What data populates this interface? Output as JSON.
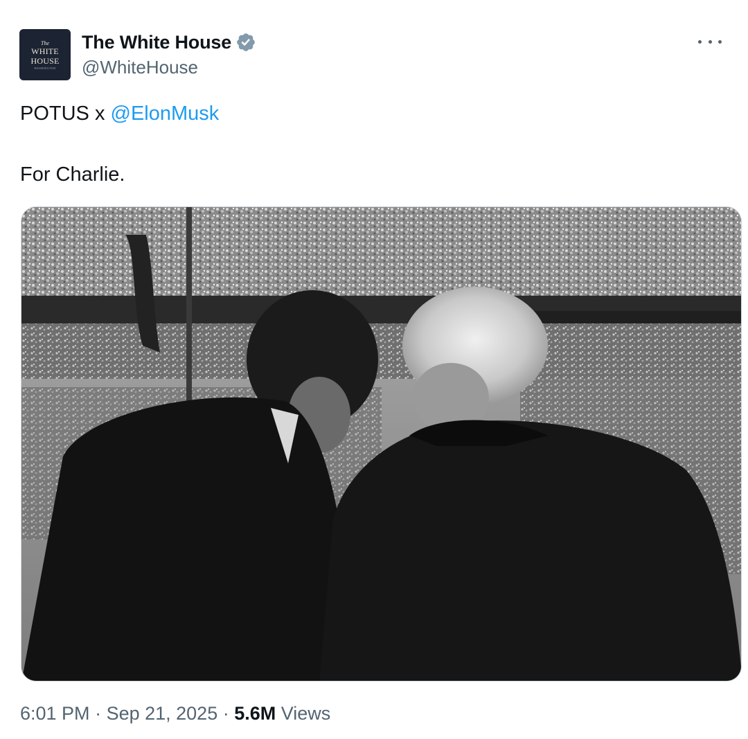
{
  "author": {
    "display_name": "The White House",
    "handle": "@WhiteHouse",
    "avatar_text": {
      "top": "The",
      "line1": "WHITE",
      "line2": "HOUSE",
      "bottom": "WASHINGTON"
    },
    "verified": true,
    "verified_badge_color": "#829aab"
  },
  "tweet": {
    "text_prefix": "POTUS x ",
    "mention": "@ElonMusk",
    "second_line": "For Charlie.",
    "photo_description_icon": "photo-image",
    "timestamp_time": "6:01 PM",
    "separator": " · ",
    "timestamp_date": "Sep 21, 2025",
    "views_count": "5.6M",
    "views_label": "Views"
  },
  "menu": {
    "more_icon": "ellipsis-icon"
  },
  "colors": {
    "text_primary": "#0f1419",
    "text_secondary": "#536471",
    "link": "#1d9bf0",
    "border": "#cfd9de"
  }
}
